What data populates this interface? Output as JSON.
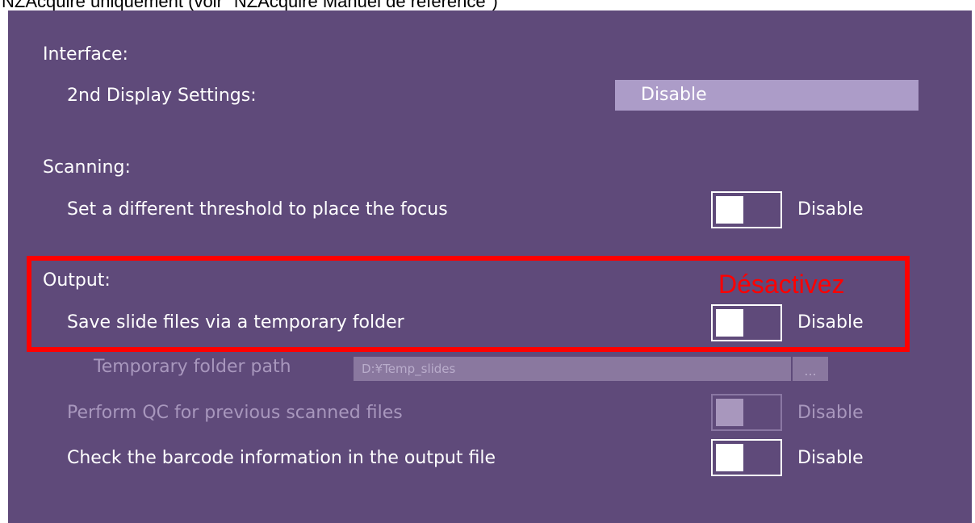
{
  "caption": "NZAcquire uniquement (voir \"NZAcquire Manuel de référence\")",
  "panel": {
    "interface": {
      "title": "Interface:",
      "second_display": {
        "label": "2nd Display Settings:",
        "value": "Disable"
      }
    },
    "scanning": {
      "title": "Scanning:",
      "focus_threshold": {
        "label": "Set a different threshold to place the focus",
        "state": "Disable"
      }
    },
    "output": {
      "title": "Output:",
      "temp_folder": {
        "label": "Save slide files via a temporary folder",
        "state": "Disable"
      },
      "temp_path": {
        "label": "Temporary folder path",
        "value": "D:¥Temp_slides",
        "browse": "..."
      },
      "qc": {
        "label": "Perform QC for previous scanned files",
        "state": "Disable"
      },
      "barcode": {
        "label": "Check the barcode information in the output file",
        "state": "Disable"
      }
    }
  },
  "annotation": {
    "text": "Désactivez",
    "color": "#ff0000"
  },
  "colors": {
    "panel_bg": "#5f4a7a",
    "dropdown_bg": "#ac9cc8",
    "highlight": "#ff0000"
  }
}
